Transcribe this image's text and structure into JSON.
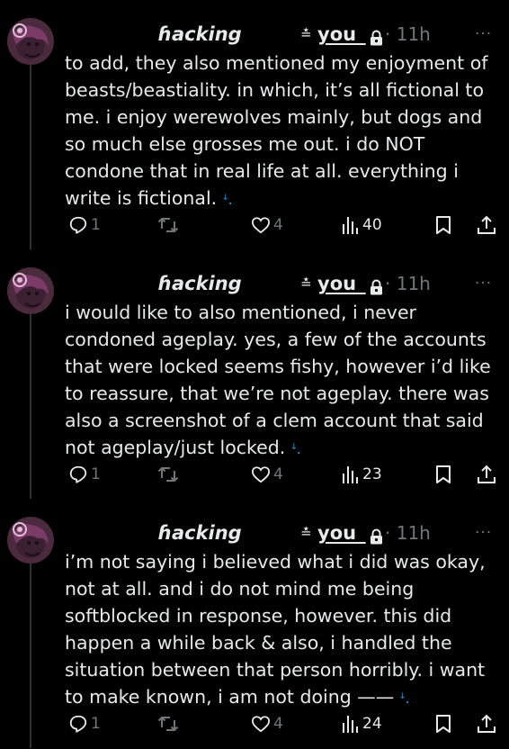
{
  "tweets": [
    {
      "author": {
        "display_name": "ɦacking",
        "handle": "you_",
        "handle_icon": "≛"
      },
      "time": "· 11h",
      "text": "to add, they also mentioned my enjoyment of\nbeasts/beastiality. in which, it’s all fictional to\nme. i enjoy werewolves mainly, but dogs and\nso much else grosses me out. i do NOT\ncondone that in real life at all. everything i\nwrite is fictional.",
      "thread_mark": "ꜜ.",
      "replies": "1",
      "likes": "4",
      "views": "40"
    },
    {
      "author": {
        "display_name": "ɦacking",
        "handle": "you_",
        "handle_icon": "≛"
      },
      "time": "· 11h",
      "text": "i would like to also mentioned, i never\ncondoned ageplay. yes, a few of the accounts\nthat were locked seems fishy, however i’d like\nto reassure, that we’re not ageplay. there was\nalso a screenshot of a clem account that said\nnot ageplay/just locked.",
      "thread_mark": "ꜜ.",
      "replies": "1",
      "likes": "4",
      "views": "23"
    },
    {
      "author": {
        "display_name": "ɦacking",
        "handle": "you_",
        "handle_icon": "≛"
      },
      "time": "· 11h",
      "text": "i’m not saying i believed what i did was okay,\nnot at all. and i do not mind me being\nsoftblocked in response, however. this did\nhappen a while back & also, i handled the\nsituation between that person horribly. i want\nto make known, i am not doing ——",
      "thread_mark": "ꜜ.",
      "replies": "1",
      "likes": "4",
      "views": "24"
    }
  ],
  "icons": {
    "more": "···",
    "lock": "lock-icon",
    "reply": "reply-icon",
    "retweet": "retweet-icon",
    "like": "heart-icon",
    "views": "views-icon",
    "bookmark": "bookmark-icon",
    "share": "share-icon"
  },
  "colors": {
    "background": "#000000",
    "text": "#e7e9ea",
    "muted": "#71767b",
    "accent": "#1d9bf0"
  }
}
